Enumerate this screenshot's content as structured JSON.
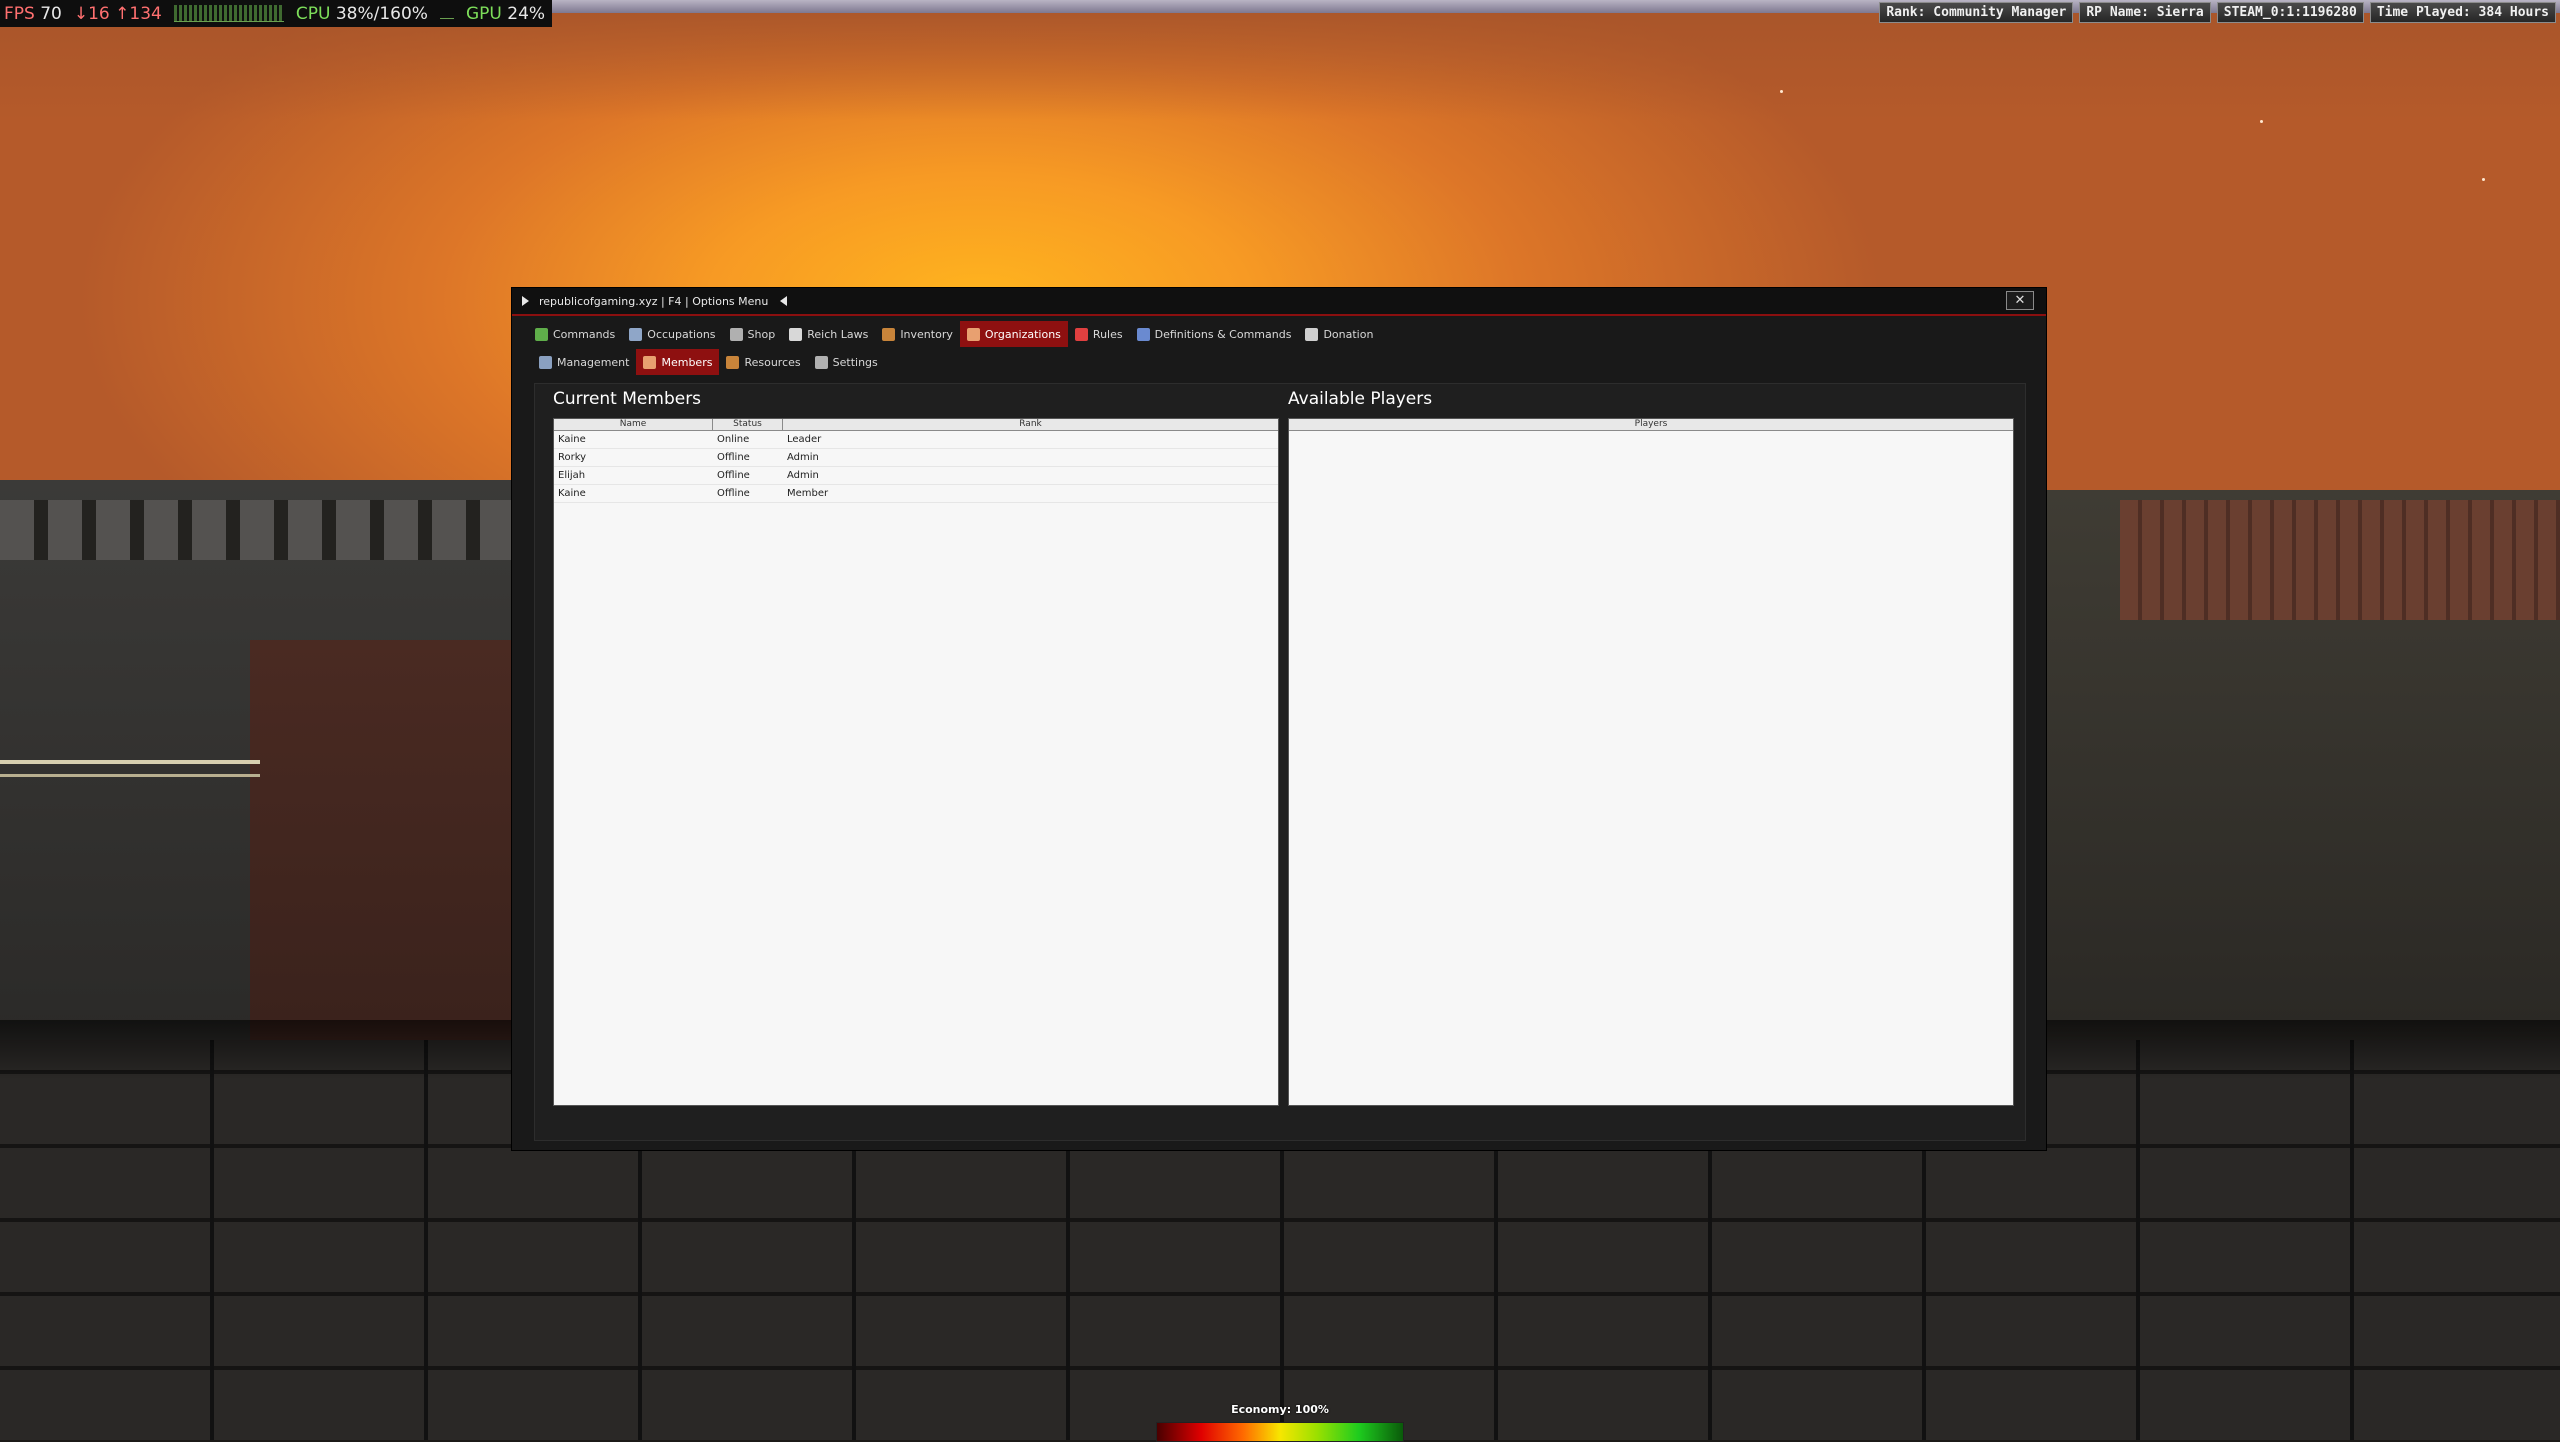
{
  "hud": {
    "fps_label": "FPS",
    "fps_value": "70",
    "ping_text": "↓16 ↑134",
    "cpu_label": "CPU",
    "cpu_value": "38%/160%",
    "gpu_label": "GPU",
    "gpu_value": "24%",
    "rank": "Rank: Community Manager",
    "rp_name": "RP Name: Sierra",
    "steam_id": "STEAM_0:1:1196280",
    "time_played": "Time Played: 384 Hours"
  },
  "window": {
    "title": "republicofgaming.xyz | F4 | Options Menu",
    "close_label": "✕"
  },
  "main_tabs": [
    {
      "label": "Commands",
      "icon": "money-icon",
      "color": "#5fae4a"
    },
    {
      "label": "Occupations",
      "icon": "person-icon",
      "color": "#8fa6c8"
    },
    {
      "label": "Shop",
      "icon": "cart-icon",
      "color": "#b0b0b0"
    },
    {
      "label": "Reich Laws",
      "icon": "list-icon",
      "color": "#d8d8d8"
    },
    {
      "label": "Inventory",
      "icon": "box-icon",
      "color": "#c8843a"
    },
    {
      "label": "Organizations",
      "icon": "group-icon",
      "color": "#e8a070",
      "active": true
    },
    {
      "label": "Rules",
      "icon": "warning-icon",
      "color": "#e04040"
    },
    {
      "label": "Definitions & Commands",
      "icon": "book-icon",
      "color": "#6a8ad0"
    },
    {
      "label": "Donation",
      "icon": "donation-icon",
      "color": "#cfcfcf"
    }
  ],
  "sub_tabs": [
    {
      "label": "Management",
      "icon": "clipboard-icon",
      "color": "#8aa0c0"
    },
    {
      "label": "Members",
      "icon": "group-icon",
      "color": "#e8a070",
      "active": true
    },
    {
      "label": "Resources",
      "icon": "resources-icon",
      "color": "#c8843a"
    },
    {
      "label": "Settings",
      "icon": "gear-icon",
      "color": "#b0b0b0"
    }
  ],
  "members": {
    "title": "Current Members",
    "columns": [
      "Name",
      "Status",
      "Rank"
    ],
    "rows": [
      {
        "name": "Kaine",
        "status": "Online",
        "rank": "Leader"
      },
      {
        "name": "Rorky",
        "status": "Offline",
        "rank": "Admin"
      },
      {
        "name": "Elijah",
        "status": "Offline",
        "rank": "Admin"
      },
      {
        "name": "Kaine",
        "status": "Offline",
        "rank": "Member"
      }
    ]
  },
  "players": {
    "title": "Available Players",
    "columns": [
      "Players"
    ]
  },
  "economy": {
    "label": "Economy: 100%",
    "value_percent": 100
  }
}
